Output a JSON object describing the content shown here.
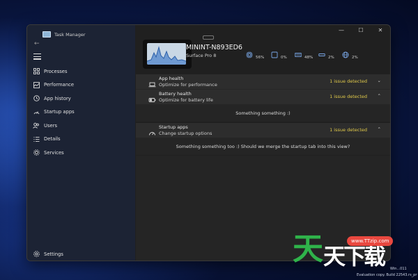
{
  "window": {
    "title": "Task Manager",
    "controls": {
      "minimize": "—",
      "maximize": "☐",
      "close": "✕"
    }
  },
  "sidebar": {
    "items": [
      {
        "label": "Processes",
        "icon": "processes-icon"
      },
      {
        "label": "Performance",
        "icon": "performance-icon"
      },
      {
        "label": "App history",
        "icon": "history-icon"
      },
      {
        "label": "Startup apps",
        "icon": "startup-icon"
      },
      {
        "label": "Users",
        "icon": "users-icon"
      },
      {
        "label": "Details",
        "icon": "details-icon"
      },
      {
        "label": "Services",
        "icon": "services-icon"
      }
    ],
    "settings_label": "Settings"
  },
  "device": {
    "name": "MININT-N893ED6",
    "model": "Surface Pro 8"
  },
  "metrics": [
    {
      "icon": "cpu-icon",
      "value": "56%"
    },
    {
      "icon": "memory-icon",
      "value": "0%"
    },
    {
      "icon": "disk-icon",
      "value": "48%"
    },
    {
      "icon": "gpu-icon",
      "value": "2%"
    },
    {
      "icon": "network-icon",
      "value": "2%"
    }
  ],
  "sections": {
    "app_health": {
      "title": "App health",
      "subtitle": "Optimize for performance",
      "status": "1 issue detected",
      "chevron": "⌄"
    },
    "battery_health": {
      "title": "Battery health",
      "subtitle": "Optimize for battery life",
      "status": "1 issue detected",
      "chevron": "⌃",
      "body": "Something something :)"
    },
    "startup_apps": {
      "title": "Startup apps",
      "subtitle": "Change startup options",
      "status": "1 issue detected",
      "chevron": "⌃",
      "body": "Something something too :) Should we merge the startup tab into this view?"
    }
  },
  "overlay": {
    "watermark_logo": "天",
    "watermark_logo2": "天下载",
    "watermark_url": "www.TTzip.com",
    "eval_line1": "Win...011",
    "eval_line2": "Evaluation copy. Build 22543.rs_pr"
  },
  "colors": {
    "accent_warning": "#e0c94a",
    "sidebar_bg": "#1c2334",
    "content_bg": "#252525"
  }
}
